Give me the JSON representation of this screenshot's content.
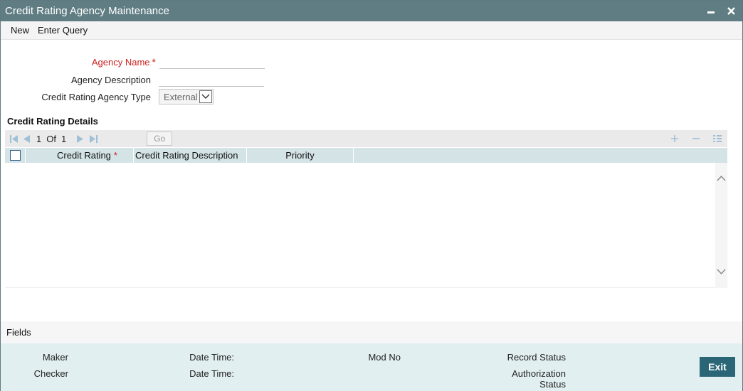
{
  "window": {
    "title": "Credit Rating Agency Maintenance"
  },
  "menu": {
    "new_label": "New",
    "enter_query_label": "Enter Query"
  },
  "form": {
    "agency_name_label": "Agency Name",
    "agency_name_value": "",
    "agency_description_label": "Agency Description",
    "agency_description_value": "",
    "agency_type_label": "Credit Rating Agency Type",
    "agency_type_selected": "External"
  },
  "details": {
    "section_title": "Credit Rating Details",
    "pager": {
      "current": "1",
      "of_label": "Of",
      "total": "1",
      "go_label": "Go"
    },
    "columns": [
      "Credit Rating",
      "Credit Rating Description",
      "Priority"
    ]
  },
  "fields_label": "Fields",
  "footer": {
    "maker_label": "Maker",
    "checker_label": "Checker",
    "date_time_label_1": "Date Time:",
    "date_time_label_2": "Date Time:",
    "mod_no_label": "Mod No",
    "record_status_label": "Record Status",
    "authorization_label_line1": "Authorization",
    "authorization_label_line2": "Status",
    "exit_label": "Exit"
  },
  "colors": {
    "titlebar": "#5f7d83",
    "required": "#cc2222",
    "grid_header": "#d3e3e6",
    "footer_bg": "#e2eff1",
    "exit_button": "#2b6676",
    "nav_icon": "#9fbfd6"
  }
}
